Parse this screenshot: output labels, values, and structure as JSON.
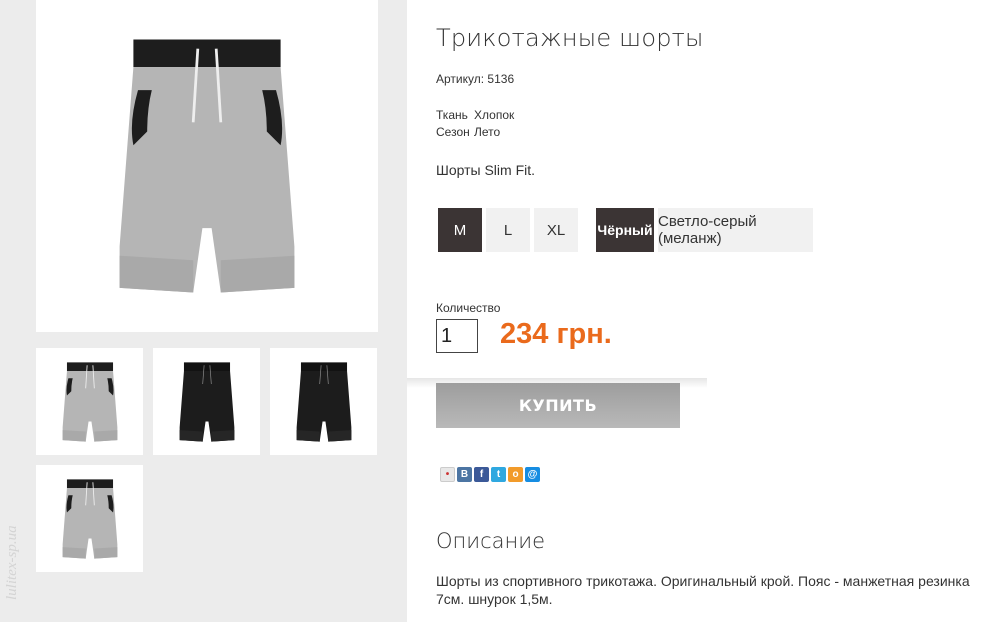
{
  "gallery": {
    "watermark": "lulitex-sp.ua",
    "main_image_alt": "Трикотажные шорты — светло-серый",
    "thumbs": [
      {
        "name": "grey-front"
      },
      {
        "name": "black-front"
      },
      {
        "name": "black-side"
      },
      {
        "name": "grey-back"
      }
    ]
  },
  "product": {
    "title": "Трикотажные шорты",
    "sku_label": "Артикул:",
    "sku": "5136",
    "attributes": [
      {
        "label": "Ткань",
        "value": "Хлопок"
      },
      {
        "label": "Сезон",
        "value": "Лето"
      }
    ],
    "short_description": "Шорты Slim Fit.",
    "sizes": [
      {
        "label": "M",
        "selected": true
      },
      {
        "label": "L",
        "selected": false
      },
      {
        "label": "XL",
        "selected": false
      }
    ],
    "colors": [
      {
        "label": "Чёрный",
        "selected": true
      },
      {
        "label": "Светло-серый (меланж)",
        "selected": false
      }
    ],
    "quantity_label": "Количество",
    "quantity": "1",
    "price": "234 грн.",
    "buy_label": "КУПИТЬ",
    "share_icons": [
      {
        "icon": "share-icon",
        "glyph": "•",
        "color": "#e8e8e8"
      },
      {
        "icon": "vk-icon",
        "glyph": "В",
        "color": "#4c75a3"
      },
      {
        "icon": "facebook-icon",
        "glyph": "f",
        "color": "#3b5998"
      },
      {
        "icon": "twitter-icon",
        "glyph": "t",
        "color": "#2fa8e0"
      },
      {
        "icon": "odnoklassniki-icon",
        "glyph": "o",
        "color": "#f29b2a"
      },
      {
        "icon": "mailru-icon",
        "glyph": "@",
        "color": "#168de2"
      }
    ],
    "description_title": "Описание",
    "description": "Шорты из спортивного трикотажа. Оригинальный крой. Пояс - манжетная резинка 7см. шнурок 1,5м."
  },
  "colors": {
    "accent": "#ea6a1c",
    "selected_option": "#3b3434",
    "option_bg": "#f1f1f1"
  }
}
